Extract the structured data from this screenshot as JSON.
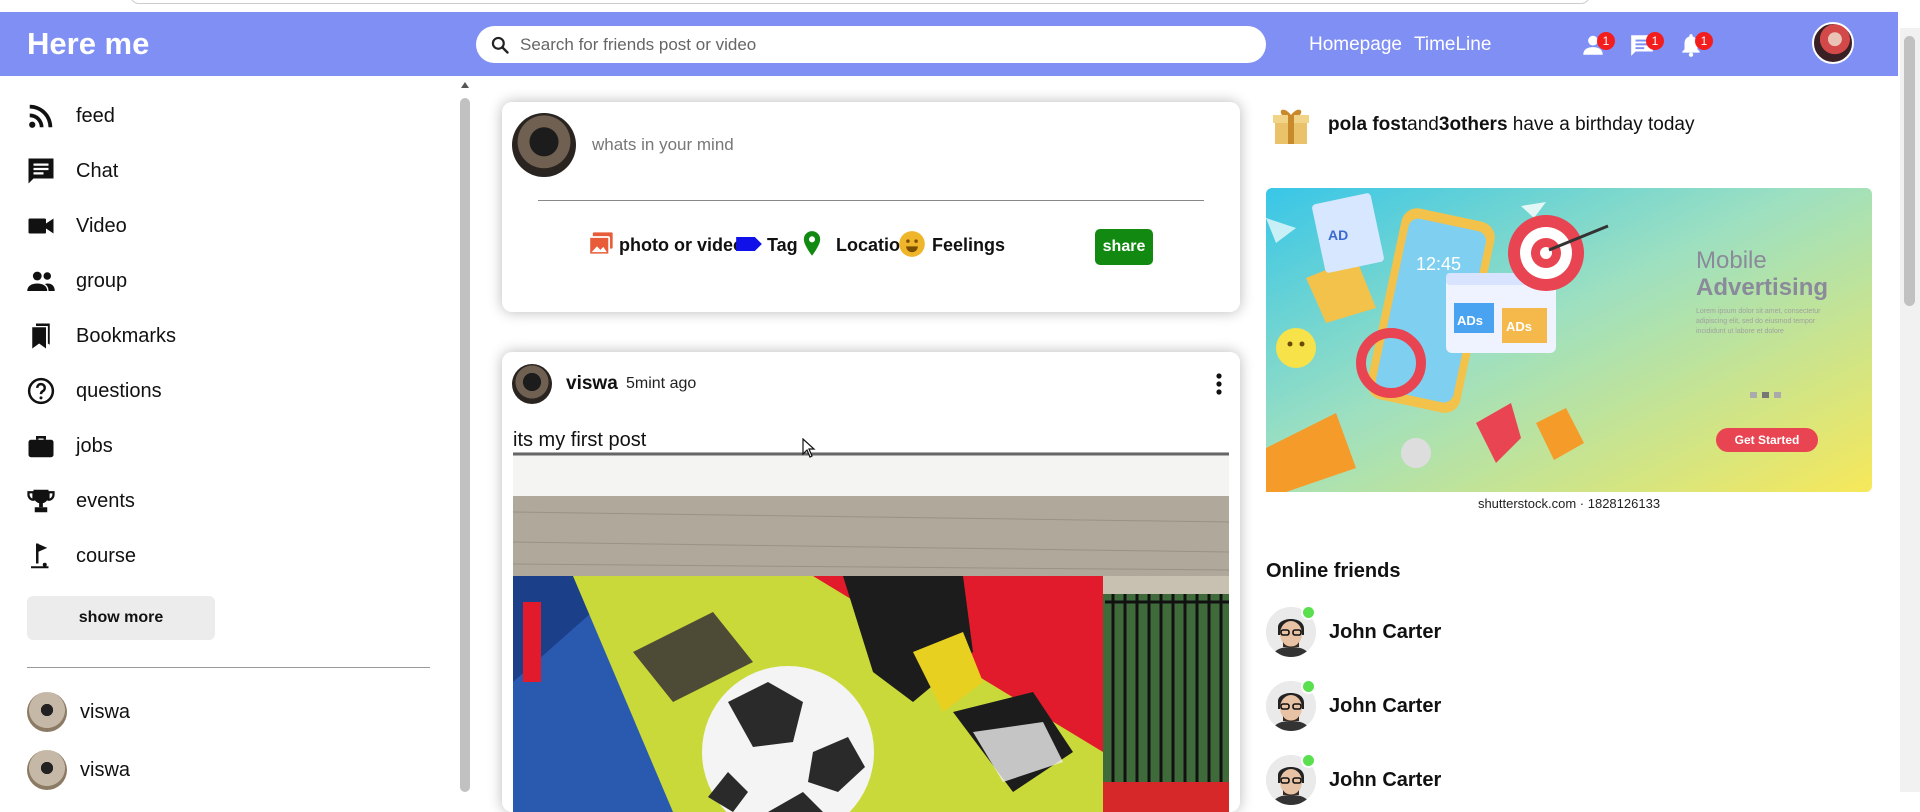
{
  "header": {
    "logo": "Here me",
    "search_placeholder": "Search for friends post or video",
    "links": [
      "Homepage",
      "TimeLine"
    ],
    "badges": {
      "friends": "1",
      "messages": "1",
      "notifications": "1"
    }
  },
  "sidebar": {
    "items": [
      {
        "label": "feed",
        "icon": "rss-icon"
      },
      {
        "label": "Chat",
        "icon": "chat-icon"
      },
      {
        "label": "Video",
        "icon": "video-icon"
      },
      {
        "label": "group",
        "icon": "group-icon"
      },
      {
        "label": "Bookmarks",
        "icon": "bookmarks-icon"
      },
      {
        "label": "questions",
        "icon": "help-icon"
      },
      {
        "label": "jobs",
        "icon": "briefcase-icon"
      },
      {
        "label": "events",
        "icon": "trophy-icon"
      },
      {
        "label": "course",
        "icon": "golf-icon"
      }
    ],
    "show_more": "show more",
    "friends": [
      "viswa",
      "viswa"
    ]
  },
  "share": {
    "placeholder": "whats in your mind",
    "options": [
      "photo or video",
      "Tag",
      "Location",
      "Feelings"
    ],
    "share_label": "share"
  },
  "post": {
    "user": "viswa",
    "time": "5mint ago",
    "text": "its my first post"
  },
  "right": {
    "birthday": {
      "name": "pola fost",
      "and": "and",
      "others": "3others",
      "rest": " have a birthday today"
    },
    "ad": {
      "title_1": "Mobile",
      "title_2": "Advertising",
      "cta": "Get Started",
      "lorem_1": "Lorem ipsum dolor sit amet, consectetur",
      "lorem_2": "adipiscing elit, sed do eiusmod tempor",
      "lorem_3": "incididunt ut labore et dolore",
      "badge_ad": "AD",
      "badge_ads": "ADs",
      "badge_ads2": "ADs",
      "phone_time": "12:45"
    },
    "ad_caption": "shutterstock.com · 1828126133",
    "online_title": "Online friends",
    "online_friends": [
      "John Carter",
      "John Carter",
      "John Carter"
    ]
  },
  "colors": {
    "topbar": "#7f8ff4",
    "share_button": "#128a12",
    "badge": "#f41d1d",
    "online_dot": "#5ae04f"
  }
}
